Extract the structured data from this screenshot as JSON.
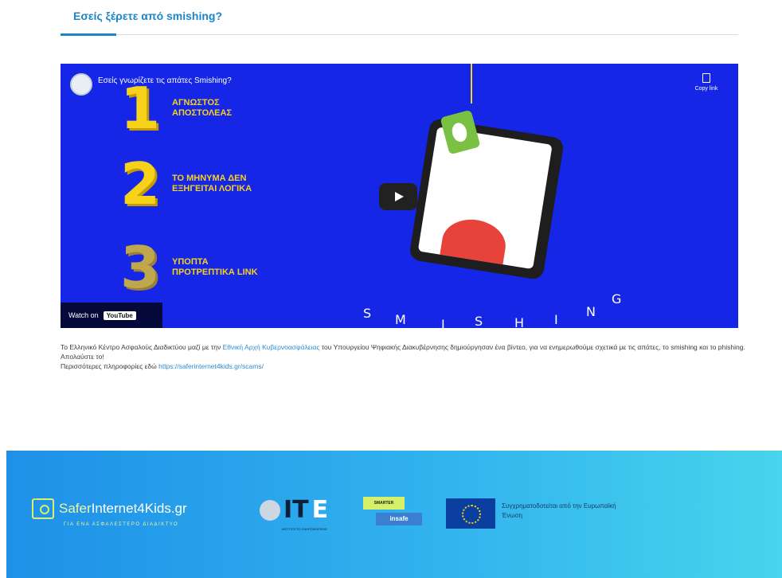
{
  "page": {
    "title": "Εσείς ξέρετε από smishing?"
  },
  "video": {
    "title": "Εσείς γνωρίζετε τις απάτες Smishing?",
    "copy_link_label": "Copy link",
    "watch_on_label": "Watch on",
    "youtube_label": "YouTube",
    "steps": [
      {
        "number": "1",
        "text": "ΑΓΝΩΣΤΟΣ ΑΠΟΣΤΟΛΕΑΣ"
      },
      {
        "number": "2",
        "text": "ΤΟ ΜΗΝΥΜΑ ΔΕΝ ΕΞΗΓΕΙΤΑΙ ΛΟΓΙΚΑ"
      },
      {
        "number": "3",
        "text": "ΥΠΟΠΤΑ ΠΡΟΤΡΕΠΤΙΚΑ LINK"
      }
    ],
    "word_letters": [
      "S",
      "M",
      "I",
      "S",
      "H",
      "I",
      "N",
      "G"
    ]
  },
  "description": {
    "line1_pre": "Το Ελληνικό Κέντρο Ασφαλούς Διαδικτύου μαζί με την ",
    "line1_link": "Εθνική Αρχή Κυβερνοασφάλειας",
    "line1_post": " του Υπουργείου Ψηφιακής Διακυβέρνησης δημιούργησαν ένα βίντεο, για να ενημερωθούμε σχετικά με τις απάτες, το smishing και το phishing. Απολαύστε το!",
    "line2_pre": "Περισσότερες πληροφορίες εδώ ",
    "line2_link": "https://saferinternet4kids.gr/scams/"
  },
  "footer": {
    "logo_name_part1": "Safer",
    "logo_name_part2": "Internet4Kids.gr",
    "logo_tagline": "ΓΙΑ ΕΝΑ ΑΣΦΑΛΕΣΤΕΡΟ ΔΙΑΔΙΚΤΥΟ",
    "ite_t": "IT",
    "ite_e": "E",
    "ite_sub": "ΙΝΣΤΙΤΟΥΤΟ ΠΛΗΡΟΦΟΡΙΚΗΣ",
    "insafe_top": "SMARTER",
    "insafe_bottom": "insafe",
    "eu_text": "Συγχρηματοδοτείται από την Ευρωπαϊκή Ένωση"
  }
}
